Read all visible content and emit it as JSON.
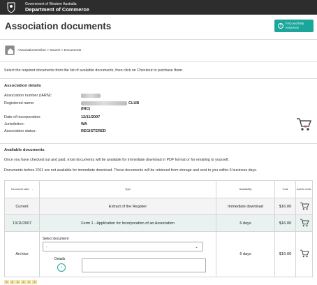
{
  "header": {
    "gov_line1": "Government of Western Australia",
    "gov_line2": "Department of Commerce"
  },
  "page": {
    "title": "Association documents",
    "help_label": "FAQ and help resources"
  },
  "breadcrumb": "AssociationsOnline > Search > Documents",
  "intro": "Select the required documents from the list of available documents, then click on Checkout to purchase them.",
  "association_details": {
    "heading": "Association details",
    "number_label": "Association number (IARN):",
    "name_label": "Registered name:",
    "name_suffix": "CLUB",
    "name_line2": "(INC)",
    "date_label": "Date of incorporation:",
    "date_value": "12/11/2007",
    "jurisdiction_label": "Jurisdiction:",
    "jurisdiction_value": "WA",
    "status_label": "Association status:",
    "status_value": "REGISTERED"
  },
  "cart": {
    "count": "0"
  },
  "available": {
    "heading": "Available documents",
    "para1": "Once you have checked out and paid, most documents will be available for immediate download in PDF format or for emailing to yourself.",
    "para2": "Documents before 2011 are not available for immediate download. These documents will be retrieved from storage and sent to you within 6 business days."
  },
  "table": {
    "headers": {
      "date": "Document date",
      "sort": "-",
      "type": "Type",
      "availability": "Availability",
      "cost": "Cost",
      "add": "Add to order"
    },
    "rows": [
      {
        "date": "Current",
        "type": "Extract of the Register",
        "availability": "Immediate download",
        "cost": "$16.00"
      },
      {
        "date": "13/11/2007",
        "type": "Form 1 - Application for Incorporation of an Association",
        "availability": "6 days",
        "cost": "$16.00"
      },
      {
        "date": "Archive",
        "type": "",
        "availability": "6 days",
        "cost": "$16.00"
      }
    ],
    "archive": {
      "select_label": "Select document",
      "select_value": "-",
      "details_label": "Details",
      "info_glyph": "i"
    }
  },
  "footer_strip": [
    "A",
    "A",
    "A",
    "A",
    "A",
    "A"
  ]
}
